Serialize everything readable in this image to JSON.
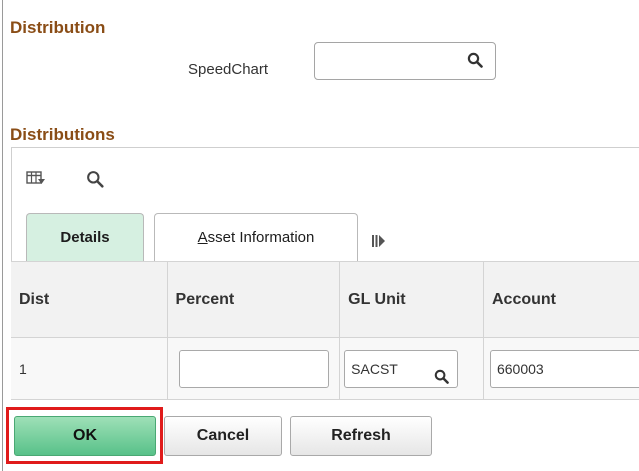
{
  "distribution_section": {
    "title": "Distribution",
    "speedchart_label": "SpeedChart",
    "speedchart_value": "",
    "search_icon": "search-icon"
  },
  "distributions_section": {
    "title": "Distributions",
    "toolbar": {
      "personalize_icon": "grid-personalize-icon",
      "find_icon": "search-icon"
    },
    "tabs": [
      {
        "label": "Details",
        "active": true
      },
      {
        "label_underlined": "A",
        "label_rest": "sset Information",
        "active": false
      }
    ],
    "show_all_tabs_icon": "show-all-tabs-icon",
    "table": {
      "headers": [
        "Dist",
        "Percent",
        "GL Unit",
        "Account"
      ],
      "rows": [
        {
          "dist": "1",
          "percent": "",
          "gl_unit": "SACST",
          "account": "660003"
        }
      ]
    }
  },
  "buttons": {
    "ok": "OK",
    "cancel": "Cancel",
    "refresh": "Refresh"
  },
  "colors": {
    "section_title": "#8a4d16",
    "ok_button": "#58c189",
    "active_tab": "#d6f0e1",
    "highlight": "#e01b1b"
  }
}
